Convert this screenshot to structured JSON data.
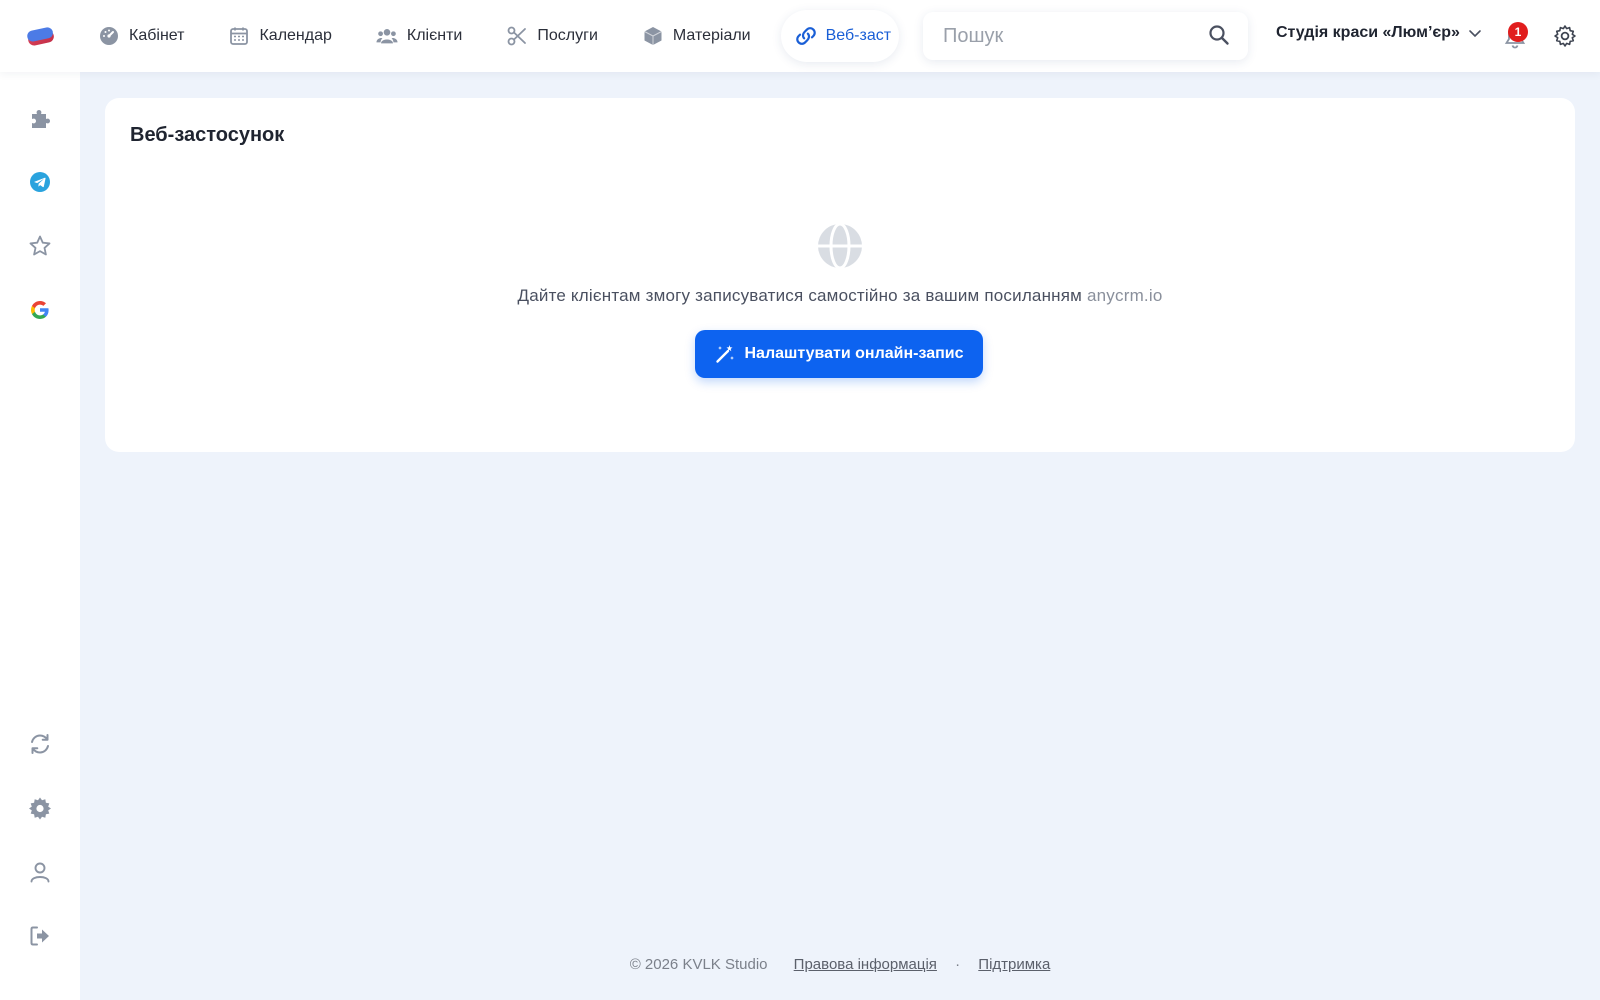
{
  "nav": {
    "items": [
      {
        "label": "Кабінет",
        "icon": "dashboard-icon"
      },
      {
        "label": "Календар",
        "icon": "calendar-icon"
      },
      {
        "label": "Клієнти",
        "icon": "users-icon"
      },
      {
        "label": "Послуги",
        "icon": "scissors-icon"
      },
      {
        "label": "Матеріали",
        "icon": "box-icon"
      },
      {
        "label": "Веб-заст",
        "icon": "link-icon",
        "active": true
      }
    ]
  },
  "search": {
    "placeholder": "Пошук",
    "value": ""
  },
  "header": {
    "studio_name": "Студія краси «Люм’єр»",
    "notification_count": "1"
  },
  "sidebar": {
    "top_icons": [
      "puzzle-icon",
      "telegram-icon",
      "star-icon",
      "google-icon"
    ],
    "bottom_icons": [
      "refresh-icon",
      "settings-icon",
      "user-icon",
      "logout-icon"
    ]
  },
  "card": {
    "title": "Веб-застосунок",
    "description": "Дайте клієнтам змогу записуватися самостійно за вашим посиланням",
    "domain": "anycrm.io",
    "cta_label": "Налаштувати онлайн-запис"
  },
  "footer": {
    "copyright": "© 2026 KVLK Studio",
    "legal_link": "Правова інформація",
    "separator": "·",
    "support_link": "Підтримка"
  },
  "colors": {
    "accent": "#0d63f0",
    "background": "#eef3fb",
    "badge": "#e11d1d",
    "telegram": "#2aa3de"
  }
}
